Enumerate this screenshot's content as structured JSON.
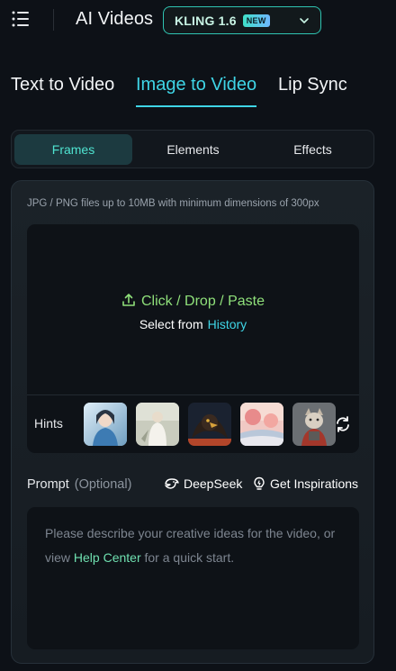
{
  "header": {
    "menu_icon": "hamburger-menu-icon",
    "title": "AI Videos",
    "model": {
      "label": "KLING 1.6",
      "badge": "NEW",
      "icon": "chevron-down-icon"
    }
  },
  "mode_tabs": [
    {
      "label": "Text to Video",
      "active": false
    },
    {
      "label": "Image to Video",
      "active": true
    },
    {
      "label": "Lip Sync",
      "active": false
    }
  ],
  "sub_tabs": [
    {
      "label": "Frames",
      "active": true
    },
    {
      "label": "Elements",
      "active": false
    },
    {
      "label": "Effects",
      "active": false
    }
  ],
  "upload": {
    "note": "JPG / PNG files up to 10MB with minimum dimensions of 300px",
    "upload_icon": "upload-icon",
    "action_click": "Click",
    "separator": "/",
    "action_drop": "Drop",
    "action_paste": "Paste",
    "select_from": "Select from",
    "history_link": "History",
    "hints_label": "Hints",
    "hints": [
      {
        "name": "hint-thumb-blue-portrait"
      },
      {
        "name": "hint-thumb-white-figure"
      },
      {
        "name": "hint-thumb-eagle"
      },
      {
        "name": "hint-thumb-pink-landscape"
      },
      {
        "name": "hint-thumb-armored-cat"
      }
    ],
    "refresh_icon": "refresh-icon"
  },
  "prompt": {
    "label": "Prompt",
    "optional": "(Optional)",
    "deepseek_label": "DeepSeek",
    "deepseek_icon": "deepseek-whale-icon",
    "inspirations_label": "Get Inspirations",
    "inspirations_icon": "lightbulb-icon",
    "placeholder_before": "Please describe your creative ideas for the video, or view",
    "help_link": "Help Center",
    "placeholder_after": "for a quick start."
  },
  "colors": {
    "background": "#0d1117",
    "accent_cyan": "#3fd5e6",
    "accent_green": "#8fe07a",
    "model_border": "#2fc4b2"
  }
}
